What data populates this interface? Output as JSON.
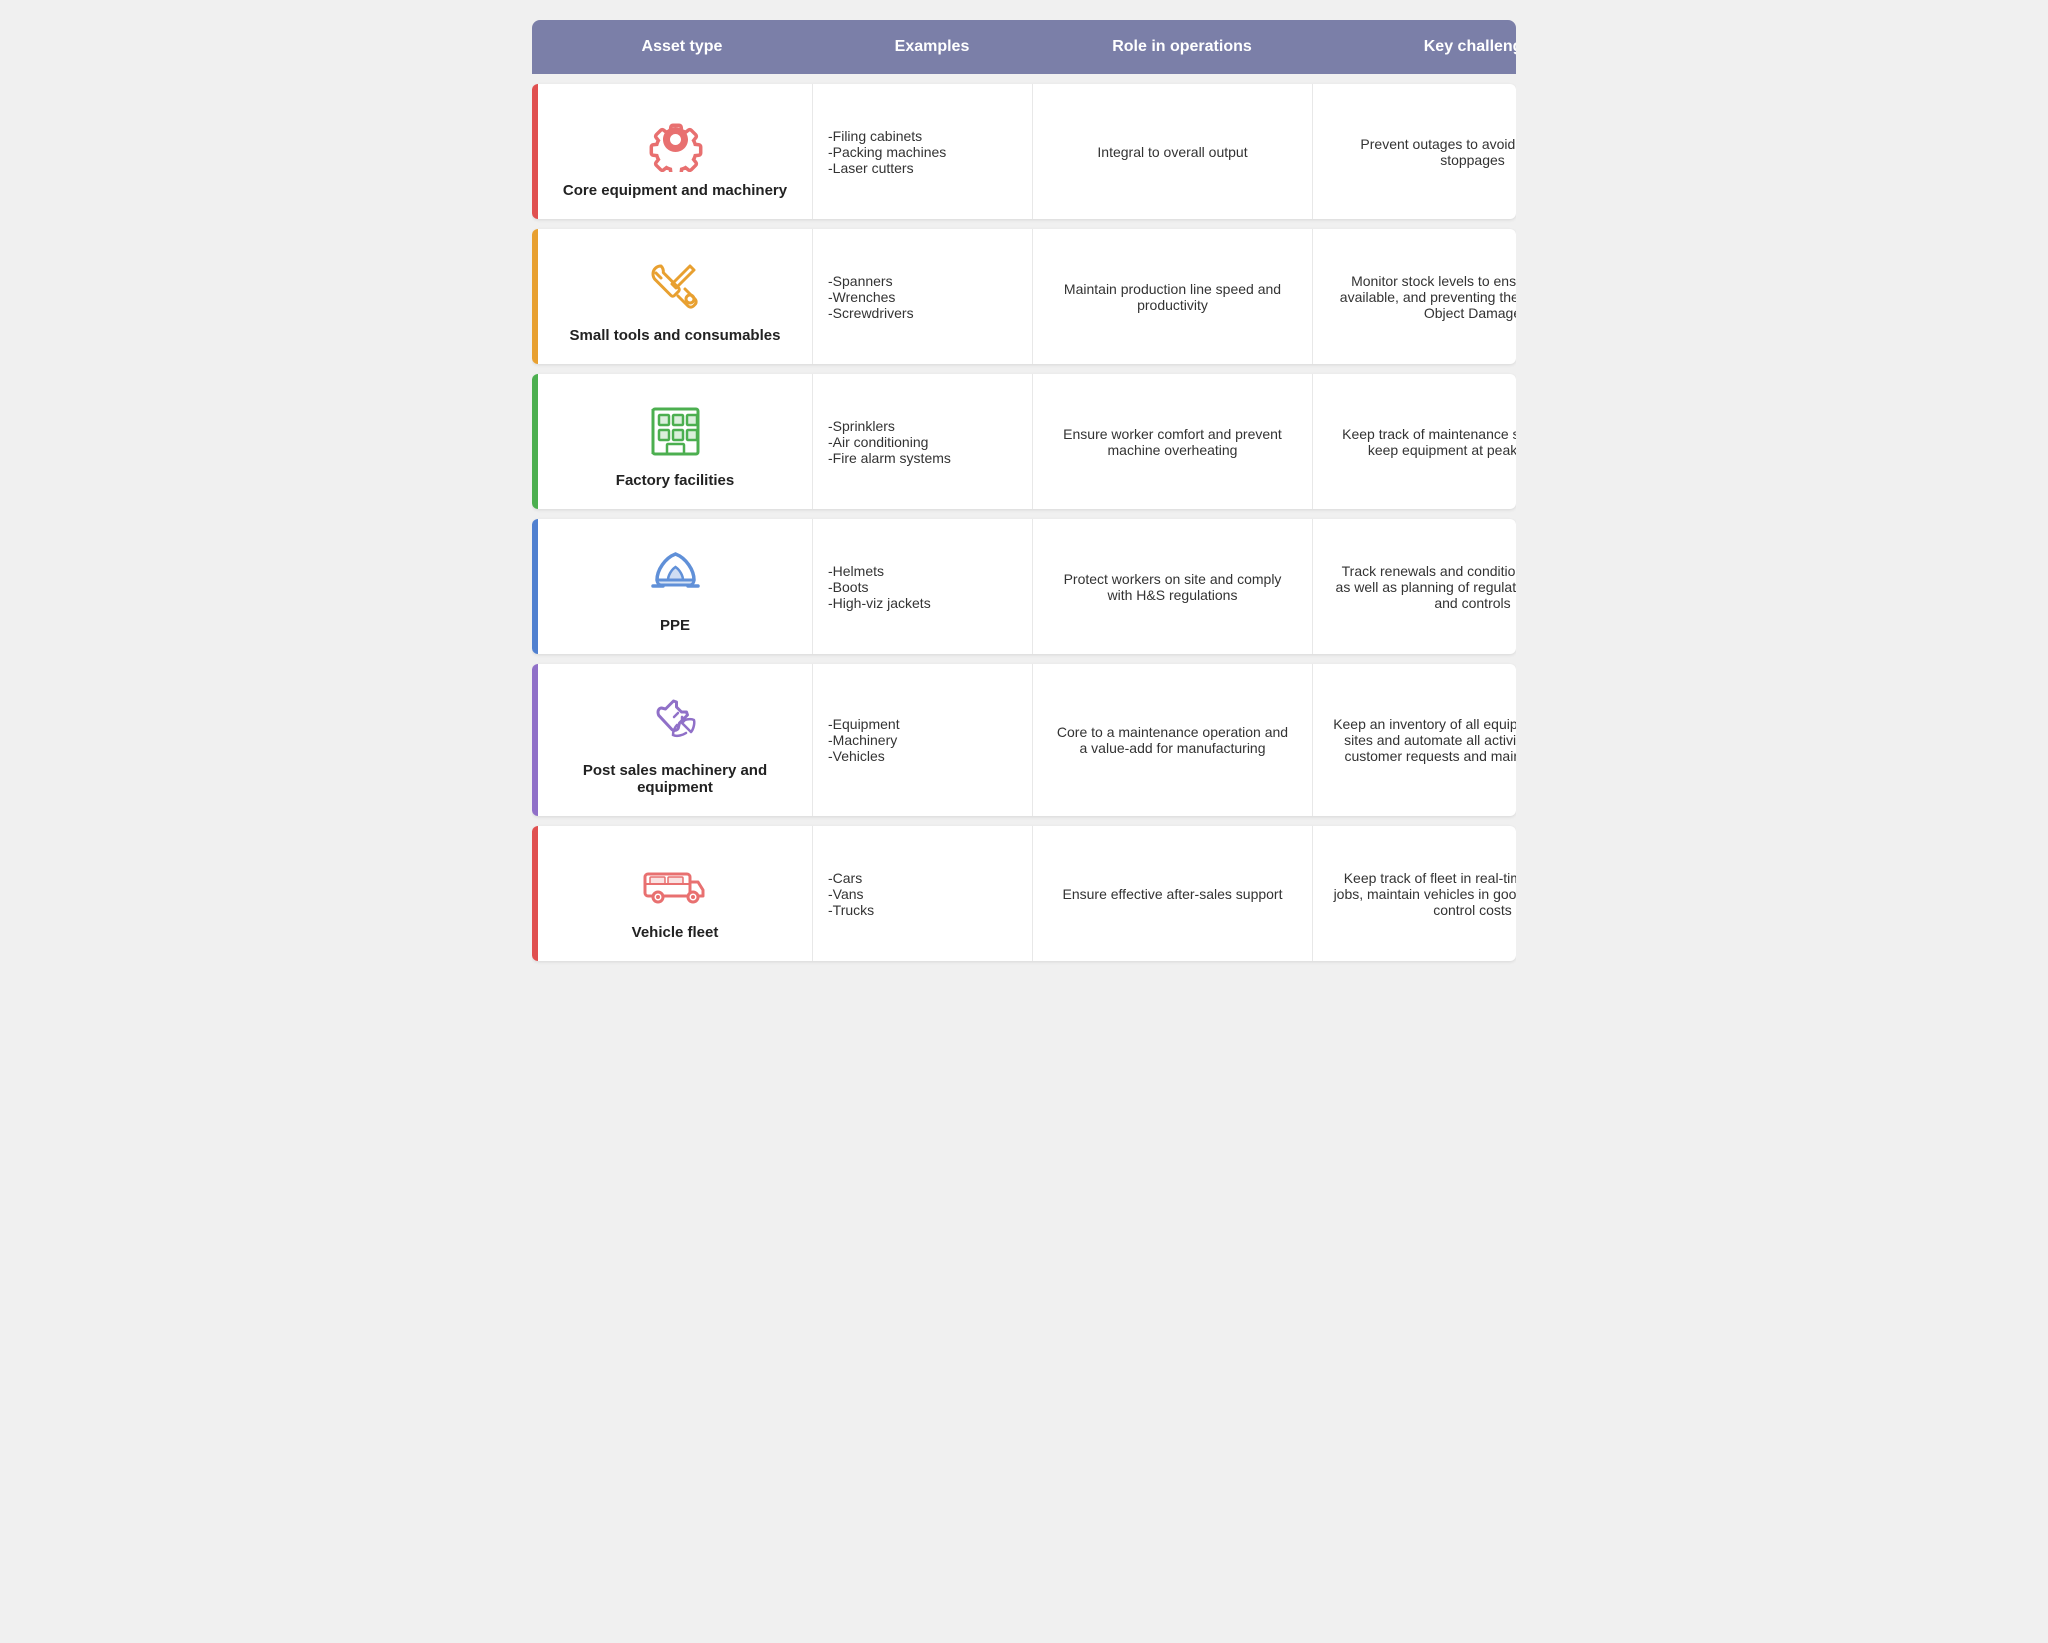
{
  "header": {
    "col1": "Asset type",
    "col2": "Examples",
    "col3": "Role in operations",
    "col4": "Key challenges"
  },
  "rows": [
    {
      "id": "core-equipment",
      "accent_color": "#e05050",
      "icon_color": "#e87070",
      "label": "Core equipment and machinery",
      "examples": [
        "-Filing cabinets",
        "-Packing machines",
        "-Laser cutters"
      ],
      "role": "Integral to overall output",
      "challenges": "Prevent outages to avoid production stoppages"
    },
    {
      "id": "small-tools",
      "accent_color": "#e8a030",
      "icon_color": "#e8a030",
      "label": "Small tools and consumables",
      "examples": [
        "-Spanners",
        "-Wrenches",
        "-Screwdrivers"
      ],
      "role": "Maintain production line speed and productivity",
      "challenges": "Monitor stock levels to ensure tools are available, and preventing theft and Foreign Object Damage"
    },
    {
      "id": "factory-facilities",
      "accent_color": "#4caf50",
      "icon_color": "#4caf50",
      "label": "Factory facilities",
      "examples": [
        "-Sprinklers",
        "-Air conditioning",
        "-Fire alarm systems"
      ],
      "role": "Ensure worker comfort and prevent machine overheating",
      "challenges": "Keep track of maintenance schedules and keep equipment at peak condition"
    },
    {
      "id": "ppe",
      "accent_color": "#5080d0",
      "icon_color": "#6090d8",
      "label": "PPE",
      "examples": [
        "-Helmets",
        "-Boots",
        "-High-viz jackets"
      ],
      "role": "Protect workers on site and comply with H&S regulations",
      "challenges": "Track renewals and conditions for workers as well as planning of regulatory inspections and controls"
    },
    {
      "id": "post-sales",
      "accent_color": "#9070c8",
      "icon_color": "#9070c8",
      "label": "Post sales machinery and equipment",
      "examples": [
        "-Equipment",
        "-Machinery",
        "-Vehicles"
      ],
      "role": "Core to a maintenance operation and a value-add for manufacturing",
      "challenges": "Keep an inventory of all equipment across all sites and automate all activities, including customer requests and maintenance jobs"
    },
    {
      "id": "vehicle-fleet",
      "accent_color": "#e05050",
      "icon_color": "#e87070",
      "label": "Vehicle fleet",
      "examples": [
        "-Cars",
        "-Vans",
        "-Trucks"
      ],
      "role": "Ensure effective after-sales support",
      "challenges": "Keep track of fleet in real-time to optimise jobs, maintain vehicles in good condition and control costs"
    }
  ]
}
